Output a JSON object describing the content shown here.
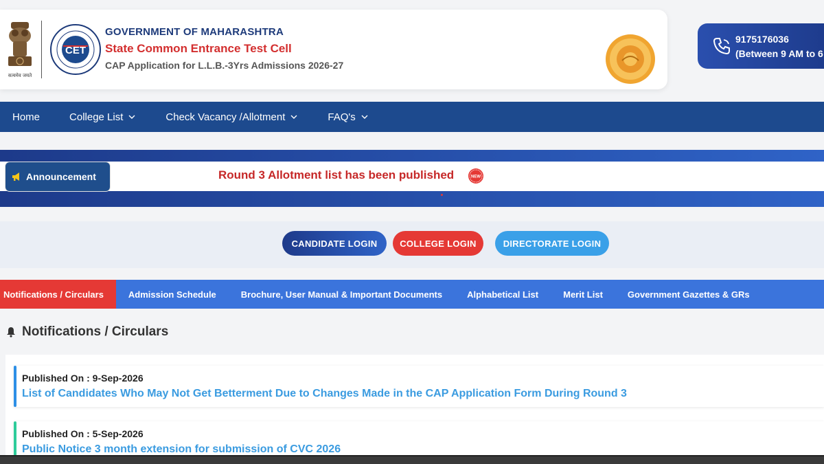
{
  "header": {
    "emblem_caption": "सत्यमेव जयते",
    "gov_title": "GOVERNMENT OF MAHARASHTRA",
    "cell_title": "State Common Entrance Test Cell",
    "cap_title": "CAP Application for L.L.B.-3Yrs Admissions 2026-27",
    "cet_logo_text": "CET",
    "helpline_number": "9175176036",
    "helpline_time": "(Between 9 AM to 6"
  },
  "nav": {
    "items": [
      {
        "label": "Home",
        "has_dropdown": false
      },
      {
        "label": "College List",
        "has_dropdown": true
      },
      {
        "label": "Check Vacancy /Allotment",
        "has_dropdown": true
      },
      {
        "label": "FAQ's",
        "has_dropdown": true
      }
    ]
  },
  "announcement": {
    "label": "Announcement",
    "text": "Round 3 Allotment list has been published",
    "badge": "NEW"
  },
  "login": {
    "candidate": "CANDIDATE LOGIN",
    "college": "COLLEGE LOGIN",
    "directorate": "DIRECTORATE LOGIN"
  },
  "tabs": [
    {
      "label": "Notifications / Circulars",
      "active": true
    },
    {
      "label": "Admission Schedule",
      "active": false
    },
    {
      "label": "Brochure, User Manual & Important Documents",
      "active": false
    },
    {
      "label": "Alphabetical List",
      "active": false
    },
    {
      "label": "Merit List",
      "active": false
    },
    {
      "label": "Government Gazettes & GRs",
      "active": false
    }
  ],
  "section": {
    "title": "Notifications / Circulars"
  },
  "notifications": [
    {
      "published": "Published On : 9-Sep-2026",
      "title": "List of Candidates Who May Not Get Betterment Due to Changes Made in the CAP Application Form During Round 3"
    },
    {
      "published": "Published On : 5-Sep-2026",
      "title": "Public Notice 3 month extension for submission of CVC 2026"
    }
  ],
  "colors": {
    "navy": "#1d4a8e",
    "red": "#e53935",
    "tab_blue": "#3b74dc",
    "link_blue": "#3a9be0"
  }
}
